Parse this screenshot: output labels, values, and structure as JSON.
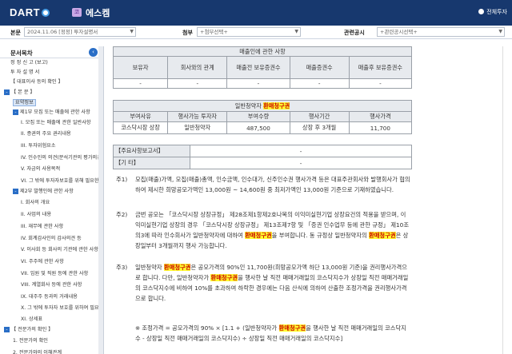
{
  "header": {
    "logo": "DART",
    "corp_badge": "코",
    "corp_name": "에스켐",
    "all_search": "전체투자"
  },
  "filter": {
    "report_label": "본문",
    "report_value": "2024.11.06 [정정] 투자설명서",
    "attach_label": "첨부",
    "attach_value": "+첨부선택+",
    "related_label": "관련공시",
    "related_value": "+관련공시선택+"
  },
  "sidebar": {
    "title": "문서목차",
    "toggle_icon": "‹",
    "items": [
      {
        "label": "정 정 신 고 (보고)"
      },
      {
        "label": "투 자 설 명 서"
      },
      {
        "label": "【 대표이사 등의 확인 】"
      },
      {
        "label": "【 본 문 】",
        "box": "-"
      },
      {
        "label": "요약정보",
        "selected": true
      },
      {
        "label": "제1부 모집 또는 매출에 관한 사항",
        "box": "-"
      },
      {
        "label": "I. 모집 또는 매출에 관한 일반사항"
      },
      {
        "label": "II. 증권의 주요 권리내용"
      },
      {
        "label": "III. 투자위험요소"
      },
      {
        "label": "IV. 인수인의 의견(분석기관의 평가의견)"
      },
      {
        "label": "V. 자금의 사용목적"
      },
      {
        "label": "VI. 그 밖에 투자자보호를 위해 필요한 사항"
      },
      {
        "label": "제2부 발행인에 관한 사항",
        "box": "-"
      },
      {
        "label": "I. 회사의 개요"
      },
      {
        "label": "II. 사업의 내용"
      },
      {
        "label": "III. 재무에 관한 사항"
      },
      {
        "label": "IV. 회계감사인의 감사의견 등"
      },
      {
        "label": "V. 이사회 등 회사의 기관에 관한 사항"
      },
      {
        "label": "VI. 주주에 관한 사항"
      },
      {
        "label": "VII. 임원 및 직원 등에 관한 사항"
      },
      {
        "label": "VIII. 계열회사 등에 관한 사항"
      },
      {
        "label": "IX. 대주주 등과의 거래내용"
      },
      {
        "label": "X. 그 밖에 투자자 보호를 위하여 필요한 사항"
      },
      {
        "label": "XI. 상세표"
      },
      {
        "label": "【 전문가의 확인 】",
        "box": "-"
      },
      {
        "label": "1. 전문가의 확인"
      },
      {
        "label": "2. 전문가와의 이해관계"
      }
    ]
  },
  "table1": {
    "title": "매출인에 관한 사항",
    "headers": [
      "보유자",
      "회사와의 관계",
      "매출전 보유증권수",
      "매출증권수",
      "매출후 보유증권수"
    ],
    "row": [
      "-",
      "-",
      "-",
      "-",
      "-"
    ]
  },
  "table2": {
    "title_pre": "일반청약자 ",
    "title_hl": "환매청구권",
    "headers": [
      "부여사유",
      "행사가능 투자자",
      "부여수량",
      "행사기간",
      "행사가격"
    ],
    "row": [
      "코스닥시장 상장",
      "일반청약자",
      "487,500",
      "상장 후 3개월",
      "11,700"
    ]
  },
  "table3": {
    "rows": [
      [
        "【주요사항보고서】",
        "-"
      ],
      [
        "【기 타】",
        "-"
      ]
    ]
  },
  "notes": {
    "n1_key": "주1)",
    "n1": "모집(매출)가액, 모집(매출)총액, 인수금액, 인수대가, 신주인수권 행사가격 등은 대표주관회사와 발행회사가 협의하여 제시한 희망공모가액인 13,000원 ~ 14,600원 중 최저가액인 13,000원 기준으로 기재하였습니다.",
    "n2_key": "주2)",
    "n2_a": "금번 공모는 「코스닥시장 상장규정」 제28조제1항제2호나목의 이익미실현기업 상장요건의 적용을 받으며, 이익미실현기업 상장의 경우 「코스닥시장 상장규정」 제13조제7항 및 「증권 인수업무 등에 관한 규정」 제10조의3에 따라 인수회사가 일반청약자에 대하여 ",
    "n2_hl1": "환매청구권",
    "n2_b": "을 부여합니다. 동 규정상 일반청약자의 ",
    "n2_hl2": "환매청구권",
    "n2_c": "은 상장일부터 3개월까지 행사 가능합니다.",
    "n3_key": "주3)",
    "n3_a": "일반청약자 ",
    "n3_hl1": "환매청구권",
    "n3_b": "은 공모가격의 90%인 11,700원(희망공모가액 하단 13,000원 기준)을 권리행사가격으로 합니다. 다만, 일반청약자가 ",
    "n3_hl2": "환매청구권",
    "n3_c": "을 행사한 날 직전 매매거래일의 코스닥지수가 상장일 직전 매매거래일의 코스닥지수에 비하여 10%를 초과하여 하락한 경우에는 다음 산식에 의하여 산출한 조정가격을 권리행사가격으로 합니다.",
    "n4_a": "※ 조정가격 = 공모가격의 90% × [1.1 + (일반청약자가 ",
    "n4_hl": "환매청구권",
    "n4_b": "을 행사한 날 직전 매매거래일의 코스닥지수 - 상장일 직전 매매거래일의 코스닥지수) ÷ 상장일 직전 매매거래일의 코스닥지수]"
  },
  "colors": {
    "topbar": "#17386e",
    "highlight": "#ffff30",
    "accent": "#2a6ec6"
  }
}
